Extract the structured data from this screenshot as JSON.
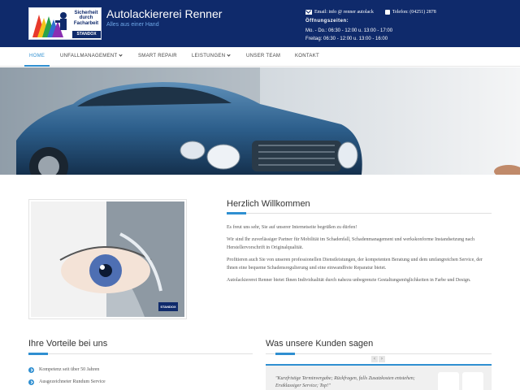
{
  "header": {
    "logo_text": "Sicherheit durch Facharbeit",
    "logo_badge": "STANDOX",
    "title": "Autolackiererei Renner",
    "subtitle": "Alles aus einer Hand",
    "email": "Email: info @ renner autolack",
    "phone": "Telefon: (04251) 2878",
    "hours_title": "Öffnungszeiten:",
    "hours": [
      "Mo. - Do.: 06:30 - 12:00 u. 13:00 - 17:00",
      "Freitag: 06:30 - 12:00 u. 13:00 - 16:00"
    ],
    "colors": {
      "header_bg": "#0f2a6b",
      "accent": "#2f8fd1"
    }
  },
  "nav": {
    "items": [
      {
        "label": "HOME",
        "active": true
      },
      {
        "label": "UNFALLMANAGEMENT",
        "dropdown": true
      },
      {
        "label": "SMART REPAIR"
      },
      {
        "label": "LEISTUNGEN",
        "dropdown": true
      },
      {
        "label": "UNSER TEAM"
      },
      {
        "label": "KONTAKT"
      }
    ]
  },
  "welcome": {
    "badge": "STANDOX",
    "title": "Herzlich Willkommen",
    "paragraphs": [
      "Es freut uns sehr, Sie auf unserer Internetseite begrüßen zu dürfen!",
      "Wir sind Ihr zuverlässiger Partner für Mobilität im Schadenfall, Schadenmanagement und werkskonforme Instandsetzung nach Herstellervorschrift in Originalqualität.",
      "Profitieren auch Sie von unseren professionellen Dienstleistungen, der kompetenten Beratung und dem umfangreichen Service, der Ihnen eine bequeme Schadensregulierung und eine einwandfreie Reparatur bietet.",
      "Autolackiererei Renner bietet Ihnen Individualität durch nahezu unbegrenzte Gestaltungsmöglichkeiten in Farbe und Design."
    ]
  },
  "vorteile": {
    "title": "Ihre Vorteile bei uns",
    "items": [
      "Kompetenz seit über 50 Jahren",
      "Ausgezeichneter Rundum Service"
    ]
  },
  "kunden": {
    "title": "Was unsere Kunden sagen",
    "prev": "‹",
    "next": "›",
    "quote": "\"Kurzfristige Terminvergabe; Rückfragen, falls Zusatzkosten entstehen; Erstklassiger Service; Top!\""
  }
}
